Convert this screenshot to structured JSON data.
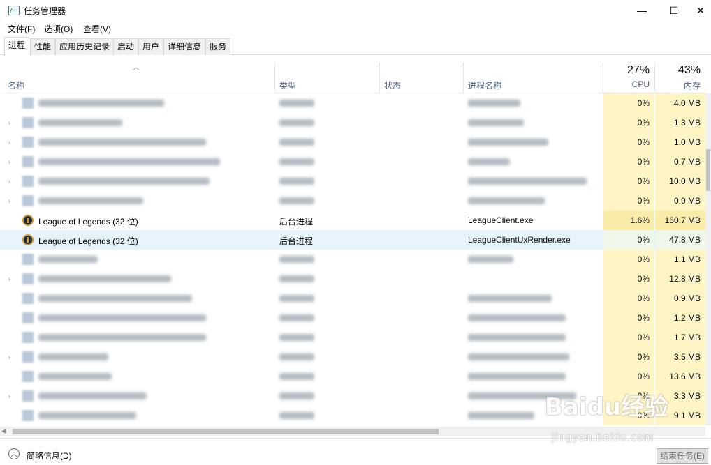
{
  "window": {
    "title": "任务管理器",
    "controls": {
      "minimize": "—",
      "maximize": "☐",
      "close": "✕"
    }
  },
  "menu": [
    "文件(F)",
    "选项(O)",
    "查看(V)"
  ],
  "tabs": [
    "进程",
    "性能",
    "应用历史记录",
    "启动",
    "用户",
    "详细信息",
    "服务"
  ],
  "active_tab": "进程",
  "columns": {
    "name": "名称",
    "type": "类型",
    "status": "状态",
    "process_name": "进程名称",
    "cpu_percent": "27%",
    "cpu_label": "CPU",
    "mem_percent": "43%",
    "mem_label": "内存"
  },
  "rows": [
    {
      "name": "",
      "type": "",
      "proc": "",
      "cpu": "0%",
      "mem": "4.0 MB",
      "blurred": true
    },
    {
      "name": "",
      "type": "",
      "proc": "",
      "cpu": "0%",
      "mem": "1.3 MB",
      "blurred": true
    },
    {
      "name": "",
      "type": "",
      "proc": "",
      "cpu": "0%",
      "mem": "1.0 MB",
      "blurred": true
    },
    {
      "name": "",
      "type": "",
      "proc": "",
      "cpu": "0%",
      "mem": "0.7 MB",
      "blurred": true
    },
    {
      "name": "",
      "type": "",
      "proc": "",
      "cpu": "0%",
      "mem": "10.0 MB",
      "blurred": true
    },
    {
      "name": "",
      "type": "",
      "proc": "",
      "cpu": "0%",
      "mem": "0.9 MB",
      "blurred": true
    },
    {
      "name": "League of Legends (32 位)",
      "type": "后台进程",
      "proc": "LeagueClient.exe",
      "cpu": "1.6%",
      "mem": "160.7 MB",
      "blurred": false
    },
    {
      "name": "League of Legends (32 位)",
      "type": "后台进程",
      "proc": "LeagueClientUxRender.exe",
      "cpu": "0%",
      "mem": "47.8 MB",
      "blurred": false,
      "selected": true
    },
    {
      "name": "",
      "type": "",
      "proc": "",
      "cpu": "0%",
      "mem": "1.1 MB",
      "blurred": true
    },
    {
      "name": "",
      "type": "",
      "proc": "",
      "cpu": "0%",
      "mem": "12.8 MB",
      "blurred": true
    },
    {
      "name": "",
      "type": "",
      "proc": "",
      "cpu": "0%",
      "mem": "0.9 MB",
      "blurred": true
    },
    {
      "name": "",
      "type": "",
      "proc": "",
      "cpu": "0%",
      "mem": "1.2 MB",
      "blurred": true
    },
    {
      "name": "",
      "type": "",
      "proc": "",
      "cpu": "0%",
      "mem": "1.7 MB",
      "blurred": true
    },
    {
      "name": "",
      "type": "",
      "proc": "",
      "cpu": "0%",
      "mem": "3.5 MB",
      "blurred": true
    },
    {
      "name": "",
      "type": "",
      "proc": "",
      "cpu": "0%",
      "mem": "13.6 MB",
      "blurred": true
    },
    {
      "name": "",
      "type": "",
      "proc": "",
      "cpu": "0%",
      "mem": "3.3 MB",
      "blurred": true
    },
    {
      "name": "",
      "type": "",
      "proc": "",
      "cpu": "0%",
      "mem": "9.1 MB",
      "blurred": true
    }
  ],
  "footer": {
    "fewer_details": "简略信息(D)",
    "end_task": "结束任务(E)"
  },
  "watermark": {
    "main": "Baidu经验",
    "sub": "jingyan.baidu.com"
  },
  "colors": {
    "usage_bg": "#fff4c4",
    "usage_hot": "#f9eca8",
    "selected_row": "#e5f3fb",
    "header_text": "#4d6082"
  }
}
